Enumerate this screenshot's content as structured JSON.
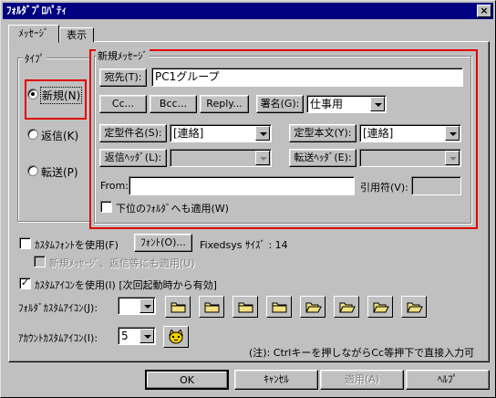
{
  "window": {
    "title": "ﾌｫﾙﾀﾞﾌﾟﾛﾊﾟﾃｨ",
    "close_label": "×"
  },
  "tabs": [
    {
      "label": "ﾒｯｾｰｼﾞ"
    },
    {
      "label": "表示"
    }
  ],
  "type_group": {
    "label": "ﾀｲﾌﾟ",
    "options": [
      {
        "label": "新規(N)",
        "selected": true
      },
      {
        "label": "返信(K)",
        "selected": false
      },
      {
        "label": "転送(P)",
        "selected": false
      }
    ]
  },
  "new_message": {
    "label": "新規ﾒｯｾｰｼﾞ",
    "to_button": "宛先(T):",
    "to_value": "PC1グループ",
    "cc_button": "Cc...",
    "bcc_button": "Bcc...",
    "reply_button": "Reply...",
    "signature_button": "署名(G):",
    "signature_value": "仕事用",
    "subject_button": "定型件名(S):",
    "subject_value": "[連絡]",
    "body_button": "定型本文(Y):",
    "body_value": "[連絡]",
    "reply_header_button": "返信ﾍｯﾀﾞ(L):",
    "reply_header_value": "",
    "forward_header_button": "転送ﾍｯﾀﾞ(E):",
    "forward_header_value": "",
    "from_label": "From:",
    "from_value": "",
    "quote_label": "引用符(V):",
    "quote_value": "",
    "apply_subfolders_label": "下位のﾌｫﾙﾀﾞへも適用(W)"
  },
  "custom_font": {
    "checkbox_label": "ｶｽﾀﾑﾌｫﾝﾄを使用(F)",
    "font_button": "ﾌｫﾝﾄ(O)...",
    "font_info": "Fixedsys ｻｲｽﾞ : 14",
    "apply_new_label": "新規ﾒｯｾｰｼﾞ、返信等にも適用(U)"
  },
  "custom_icon": {
    "checkbox_label": "ｶｽﾀﾑｱｲｺﾝを使用(I) [次回起動時から有効]",
    "folder_icon_label": "ﾌｫﾙﾀﾞｶｽﾀﾑｱｲｺﾝ(J):",
    "folder_icon_value": "",
    "folder_icons": [
      "folder-closed-icon",
      "folder-closed-icon",
      "folder-closed-icon",
      "folder-closed-icon",
      "folder-open-icon",
      "folder-open-icon",
      "folder-open-icon",
      "folder-open-icon"
    ],
    "account_icon_label": "ｱｶｳﾝﾄｶｽﾀﾑｱｲｺﾝ(I):",
    "account_icon_value": "5",
    "account_icon": "cat-face-icon"
  },
  "note": "(注): Ctrlキーを押しながらCc等押下で直接入力可",
  "footer": {
    "ok": "OK",
    "cancel": "ｷｬﾝｾﾙ",
    "apply": "適用(A)",
    "help": "ﾍﾙﾌﾟ"
  },
  "colors": {
    "title_bar": "#000080",
    "highlight_box": "#e00000",
    "folder_yellow": "#f0e080"
  }
}
